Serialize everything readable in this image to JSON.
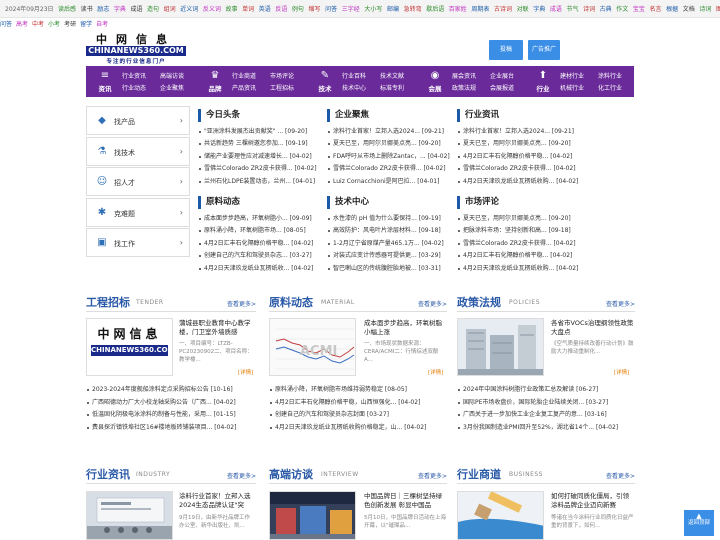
{
  "topbar": {
    "date": "2024年09月23日",
    "links": [
      {
        "t": "读后感",
        "c": "#2a8a2a"
      },
      {
        "t": "读书",
        "c": "#333"
      },
      {
        "t": "励志",
        "c": "#1a5aa8"
      },
      {
        "t": "字典",
        "c": "#c030c0"
      },
      {
        "t": "成语",
        "c": "#333"
      },
      {
        "t": "造句",
        "c": "#2a8a2a"
      },
      {
        "t": "组词",
        "c": "#c03030"
      },
      {
        "t": "近义词",
        "c": "#1a5aa8"
      },
      {
        "t": "反义词",
        "c": "#c030c0"
      },
      {
        "t": "故事",
        "c": "#2a8a2a"
      },
      {
        "t": "单词",
        "c": "#c03030"
      },
      {
        "t": "英语",
        "c": "#1a5aa8"
      },
      {
        "t": "反语",
        "c": "#c030c0"
      },
      {
        "t": "例句",
        "c": "#2a8a2a"
      },
      {
        "t": "缩写",
        "c": "#c03030"
      },
      {
        "t": "问答",
        "c": "#1a5aa8"
      },
      {
        "t": "三字经",
        "c": "#c030c0"
      },
      {
        "t": "大小写",
        "c": "#2a8a2a"
      },
      {
        "t": "邮编",
        "c": "#1a5aa8"
      },
      {
        "t": "急转弯",
        "c": "#c03030"
      },
      {
        "t": "歇后语",
        "c": "#2a8a2a"
      },
      {
        "t": "百家姓",
        "c": "#c030c0"
      },
      {
        "t": "周期表",
        "c": "#1a5aa8"
      },
      {
        "t": "古诗词",
        "c": "#c03030"
      },
      {
        "t": "对联",
        "c": "#2a8a2a"
      },
      {
        "t": "字典",
        "c": "#1a5aa8"
      },
      {
        "t": "成语",
        "c": "#c030c0"
      },
      {
        "t": "节气",
        "c": "#2a8a2a"
      },
      {
        "t": "诗词",
        "c": "#c03030"
      },
      {
        "t": "古典",
        "c": "#1a5aa8"
      },
      {
        "t": "作文",
        "c": "#2a8a2a"
      },
      {
        "t": "宝宝",
        "c": "#c030c0"
      },
      {
        "t": "名言",
        "c": "#c03030"
      },
      {
        "t": "根据",
        "c": "#1a5aa8"
      },
      {
        "t": "文档",
        "c": "#333"
      },
      {
        "t": "诗词",
        "c": "#2a8a2a"
      },
      {
        "t": "图书",
        "c": "#c03030"
      }
    ]
  },
  "sublinks": [
    {
      "t": "问答",
      "c": "#1a5aa8"
    },
    {
      "t": "高考",
      "c": "#c030c0"
    },
    {
      "t": "中考",
      "c": "#c03030"
    },
    {
      "t": "小考",
      "c": "#2a8a2a"
    },
    {
      "t": "考研",
      "c": "#333"
    },
    {
      "t": "留学",
      "c": "#1a5aa8"
    },
    {
      "t": "自考",
      "c": "#c030c0"
    }
  ],
  "logo": {
    "line1": "中网信息",
    "line2": "CHINANEWS360.COM",
    "line3": "专注的行业信息门户"
  },
  "header_buttons": {
    "submit": "投稿",
    "ads": "广告推广"
  },
  "nav": {
    "groups": [
      {
        "name": "资讯",
        "icon": "≡",
        "links": [
          "行业资讯",
          "高端访谈",
          "行业动态",
          "企业聚焦"
        ]
      },
      {
        "name": "品牌",
        "icon": "♛",
        "links": [
          "行业商道",
          "市场评论",
          "产品资讯",
          "工程招标"
        ]
      },
      {
        "name": "技术",
        "icon": "✎",
        "links": [
          "行业百科",
          "技术文献",
          "技术中心",
          "标准专利"
        ]
      },
      {
        "name": "会展",
        "icon": "◉",
        "links": [
          "展会资讯",
          "企业展台",
          "政策法规",
          "会展报道"
        ]
      },
      {
        "name": "行业",
        "icon": "⬆",
        "links": [
          "建材行业",
          "涂料行业",
          "机械行业",
          "化工行业"
        ]
      }
    ]
  },
  "sidebar": [
    {
      "label": "找产品",
      "icon": "cube-icon",
      "glyph": "◆"
    },
    {
      "label": "找技术",
      "icon": "flask-icon",
      "glyph": "⚗"
    },
    {
      "label": "招人才",
      "icon": "person-icon",
      "glyph": "☺"
    },
    {
      "label": "克难题",
      "icon": "puzzle-icon",
      "glyph": "✱"
    },
    {
      "label": "找工作",
      "icon": "briefcase-icon",
      "glyph": "▣"
    }
  ],
  "columns": {
    "today": {
      "title": "今日头条",
      "items": [
        "\"亚洲涂料发展杰出贡献奖\" ... [09-20]",
        "共话新趋势 三棵树邀您参加... [09-19]",
        "储能产业要理性应对减速增长... [04-02]",
        "雪佛兰Colorado ZR2皮卡获得... [04-02]",
        "兰州石化LDPE装置动态，兰州... [04-01]"
      ]
    },
    "enterprise": {
      "title": "企业聚焦",
      "items": [
        "涂料行业首家！立邦入选2024... [09-21]",
        "夏天已至，用阿尔贝娜美点亮... [09-20]",
        "FDA呼吁从市场上删除Zantac，... [04-02]",
        "雪佛兰Colorado ZR2皮卡获得... [04-02]",
        "Luiz Cornacchioni是阿巴拉... [04-01]"
      ]
    },
    "industry": {
      "title": "行业资讯",
      "items": [
        "涂料行业首家！立邦入选2024... [09-21]",
        "夏天已至，用阿尔贝娜美点亮... [09-20]",
        "4月2日汇丰石化隔醇价格平稳... [04-02]",
        "雪佛兰Colorado ZR2皮卡获得... [04-02]",
        "4月2日天津玖龙纸业瓦楞纸收购... [04-02]"
      ]
    },
    "material": {
      "title": "原料动态",
      "items": [
        "成本面步步趋高，环氧树脂小... [09-09]",
        "原料涌小降，环氧树脂市场... [08-05]",
        "4月2日汇丰石化隔醇价格平稳... [04-02]",
        "创建自己的汽车和驾驶员杂志... [03-27]",
        "4月2日天津玖龙纸业瓦楞纸收... [04-02]"
      ]
    },
    "tech": {
      "title": "技术中心",
      "items": [
        "水性漆的 pH 值为什么要保持... [09-19]",
        "高效防护：风电叶片涂层材料... [09-18]",
        "1-2月辽宁省原煤产量465.1万... [04-02]",
        "对装式应变计传感器可提供更... [03-29]",
        "智巴喇山区的传统腹腔胎地被... [03-31]"
      ]
    },
    "market": {
      "title": "市场评论",
      "items": [
        "夏天已至，用阿尔贝娜美点亮... [09-20]",
        "把脉涂料市场：坚持创新和高... [09-18]",
        "雪佛兰Colorado ZR2皮卡获得... [04-02]",
        "4月2日汇丰石化隔醇价格平稳... [04-02]",
        "4月2日天津玖龙纸业瓦楞纸收购... [04-02]"
      ]
    }
  },
  "sections": {
    "tender": {
      "title": "工程招标",
      "sub": "TENDER",
      "more": "查看更多>",
      "feature_title": "蒲城县职业教育中心教学楼，门卫室外墙质感",
      "feature_desc": "一、项目编号：LTZB-PC20230902二、项目名称：教学楼...",
      "detail": "[详情]",
      "thumb_l1": "中网信息",
      "thumb_l2": "CHINANEWS360.COM",
      "items": [
        "2023-2024年度舰船涂料定点采购招标公告 [10-16]",
        "广西昭德动力厂大小校龙轴采购公告（广西... [04-02]",
        "低温固化阴极电泳涂料的制备与性能，采用... [01-15]",
        "费县探沂镇铁埠社区16#楼地板砖铺装项目... [04-02]"
      ]
    },
    "material": {
      "title": "原料动态",
      "sub": "MATERIAL",
      "more": "查看更多>",
      "feature_title": "成本面步步趋高，环氧树脂小幅上涨",
      "feature_desc": "一、市场现状数据来源：CERA/ACMI二：行情综述双酚A...",
      "detail": "[详情]",
      "items": [
        "原料涌小降，环氧树脂市场维持弱势稳定 [08-05]",
        "4月2日汇丰石化隔醇价格平稳，山西恒强化... [04-02]",
        "创建自己的汽车和驾驶员杂志封面 [03-27]",
        "4月2日天津玖龙纸业瓦楞纸收购价格稳定，山... [04-02]"
      ]
    },
    "policy": {
      "title": "政策法规",
      "sub": "POLICIES",
      "more": "查看更多>",
      "feature_title": "各省市VOCs治理纲领性政策大盘点",
      "feature_desc": "《空气质量持续改善行动计划》鼓励大力推动重制化...",
      "detail": "[详情]",
      "items": [
        "2024年中国涂料树脂行业政策汇总及解读 [06-27]",
        "国际PE市场收盘价，国际轮胎企业陆续关闭... [03-27]",
        "广西关于进一步加快工业企业复工复产的意... [03-16]",
        "3月份我国制造业PMI回升至52%，湖北省14个... [04-02]"
      ]
    },
    "industry": {
      "title": "行业资讯",
      "sub": "INDUSTRY",
      "more": "查看更多>",
      "feature_title": "涂料行业首家！立邦入选2024生态品牌认证\"突",
      "feature_desc": "9月19日，由新华社品牌工作办公室、新华出版社、凯..."
    },
    "interview": {
      "title": "高端访谈",
      "sub": "INTERVIEW",
      "more": "查看更多>",
      "feature_title": "中国品牌日｜三棵树坚持绿色创新发展 彰显中国品",
      "feature_desc": "5月10日，中国品牌日活动在上海开幕，以\"璀璨品..."
    },
    "business": {
      "title": "行业商道",
      "sub": "BUSINESS",
      "more": "查看更多>",
      "feature_title": "如何打破同质化僵局，引领涂料品牌企业迈向新赛",
      "feature_desc": "等诸在当今涂料行业同质化日益严重的背景下，如何..."
    }
  },
  "backtop": "返回顶部"
}
